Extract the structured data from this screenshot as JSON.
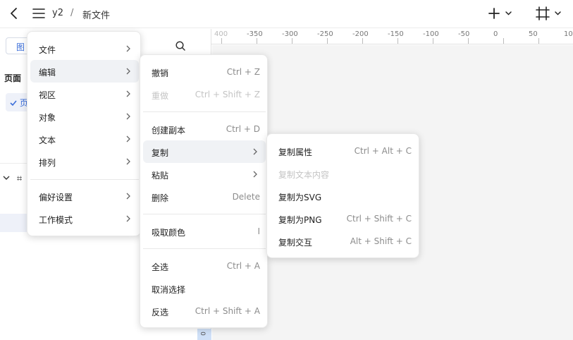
{
  "header": {
    "project": "y2",
    "separator": "/",
    "file": "新文件"
  },
  "left_panel": {
    "tab": "图",
    "pages_title": "页面",
    "page_item": "页",
    "layer_label": "⌗"
  },
  "ruler": {
    "ticks": [
      "400",
      "-350",
      "-300",
      "-250",
      "-200",
      "-150",
      "-100",
      "-50",
      "0",
      "50",
      "10"
    ],
    "left_marker": "0"
  },
  "main_menu": {
    "items": [
      {
        "label": "文件"
      },
      {
        "label": "编辑"
      },
      {
        "label": "视区"
      },
      {
        "label": "对象"
      },
      {
        "label": "文本"
      },
      {
        "label": "排列"
      },
      {
        "label": "偏好设置"
      },
      {
        "label": "工作模式"
      }
    ]
  },
  "edit_menu": {
    "items": [
      {
        "label": "撤销",
        "shortcut": "Ctrl + Z"
      },
      {
        "label": "重做",
        "shortcut": "Ctrl + Shift + Z"
      },
      {
        "label": "创建副本",
        "shortcut": "Ctrl + D"
      },
      {
        "label": "复制",
        "shortcut": ""
      },
      {
        "label": "粘贴",
        "shortcut": ""
      },
      {
        "label": "删除",
        "shortcut": "Delete"
      },
      {
        "label": "吸取颜色",
        "shortcut": "I"
      },
      {
        "label": "全选",
        "shortcut": "Ctrl + A"
      },
      {
        "label": "取消选择",
        "shortcut": ""
      },
      {
        "label": "反选",
        "shortcut": "Ctrl + Shift + A"
      }
    ]
  },
  "copy_menu": {
    "items": [
      {
        "label": "复制属性",
        "shortcut": "Ctrl + Alt + C"
      },
      {
        "label": "复制文本内容",
        "shortcut": ""
      },
      {
        "label": "复制为SVG",
        "shortcut": ""
      },
      {
        "label": "复制为PNG",
        "shortcut": "Ctrl + Shift + C"
      },
      {
        "label": "复制交互",
        "shortcut": "Alt + Shift + C"
      }
    ]
  },
  "colors": {
    "accent": "#3b6ed9",
    "hover_bg": "#f0f2f5",
    "disabled_text": "#c4c4c4"
  }
}
